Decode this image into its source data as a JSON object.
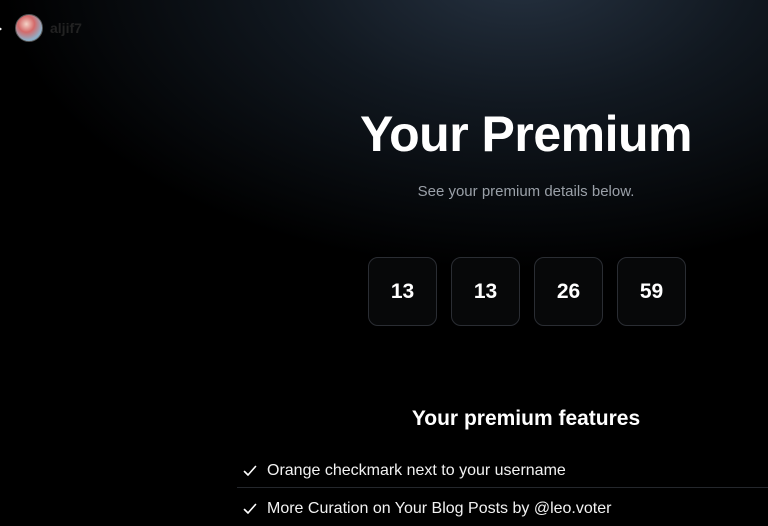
{
  "user": {
    "username": "aljif7",
    "avatar_icon": "user-avatar"
  },
  "header": {
    "title": "Your Premium",
    "subtitle": "See your premium details below."
  },
  "countdown": [
    "13",
    "13",
    "26",
    "59"
  ],
  "features": {
    "title": "Your premium features",
    "items": [
      "Orange checkmark next to your username",
      "More Curation on Your Blog Posts by @leo.voter"
    ]
  },
  "colors": {
    "background": "#000000",
    "text": "#ffffff",
    "subtext": "#9aa0a8",
    "box_border": "#2a2d33"
  }
}
